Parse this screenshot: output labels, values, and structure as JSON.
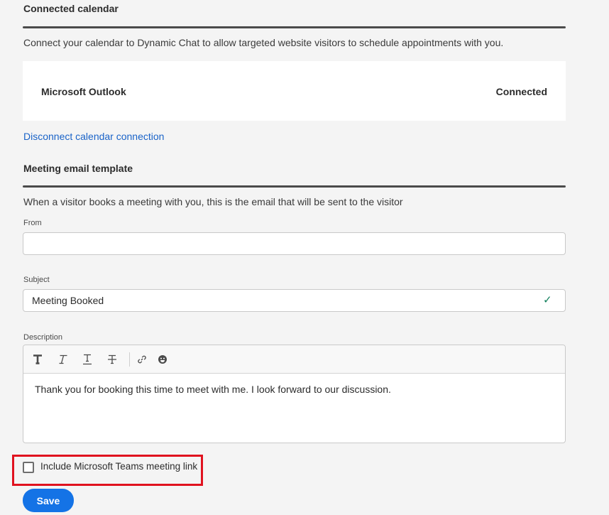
{
  "connected_calendar": {
    "title": "Connected calendar",
    "description": "Connect your calendar to Dynamic Chat to allow targeted website visitors to schedule appointments with you.",
    "provider": "Microsoft Outlook",
    "status": "Connected",
    "disconnect_link": "Disconnect calendar connection"
  },
  "meeting_email": {
    "title": "Meeting email template",
    "description": "When a visitor books a meeting with you, this is the email that will be sent to the visitor",
    "from_label": "From",
    "from_value": "",
    "subject_label": "Subject",
    "subject_value": "Meeting Booked",
    "subject_valid_icon": "checkmark-icon",
    "description_label": "Description",
    "toolbar": [
      "bold-icon",
      "italic-icon",
      "underline-icon",
      "strikethrough-icon",
      "link-icon",
      "emoji-icon"
    ],
    "body": "Thank you for booking this time to meet with me. I look forward to our discussion."
  },
  "teams": {
    "label": "Include Microsoft Teams meeting link",
    "checked": false
  },
  "save_label": "Save",
  "colors": {
    "accent": "#1473e6",
    "link": "#1a63c8",
    "success": "#12805c",
    "highlight": "#e0121f"
  }
}
